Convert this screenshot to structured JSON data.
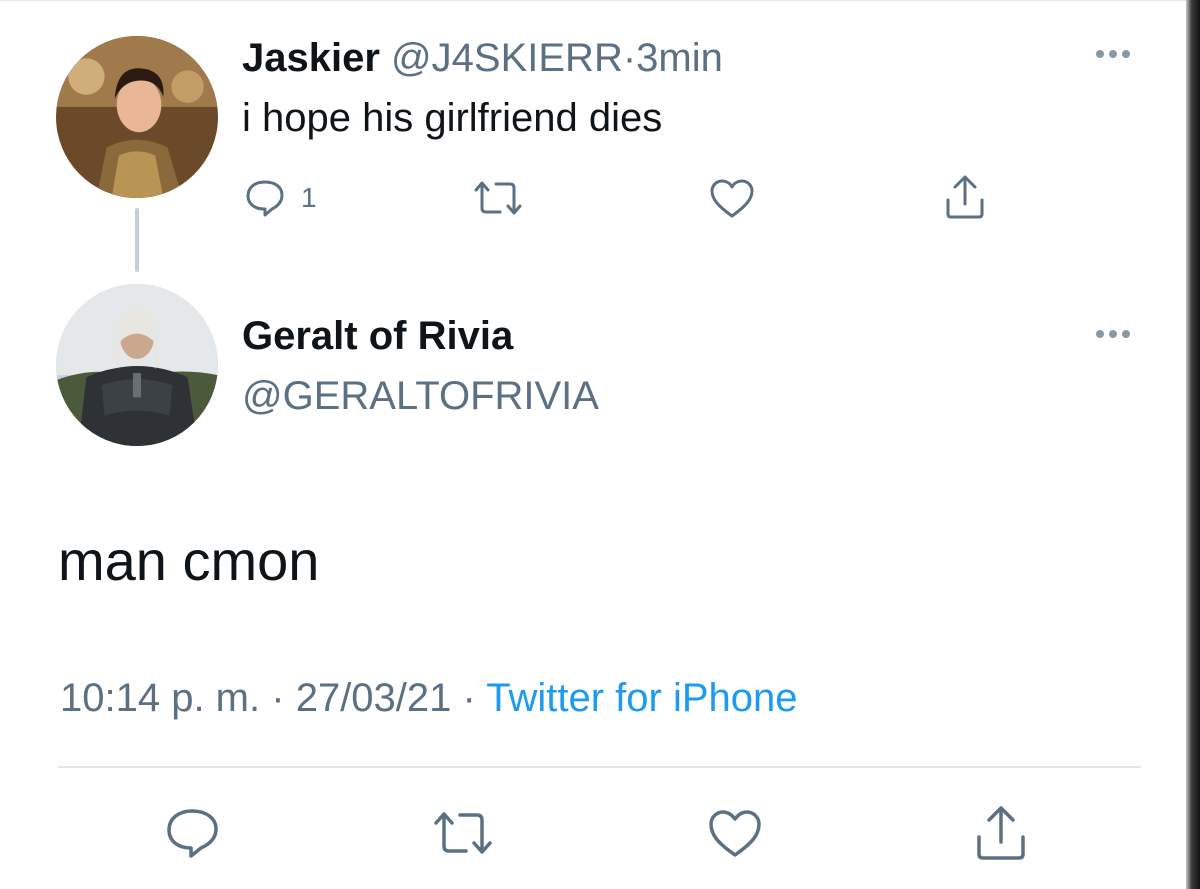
{
  "parent_tweet": {
    "display_name": "Jaskier",
    "handle": "@J4SKIERR",
    "separator": "·",
    "time": "3min",
    "text": "i hope his girlfriend dies",
    "reply_count": "1"
  },
  "main_tweet": {
    "display_name": "Geralt of Rivia",
    "handle": "@GERALTOFRIVIA",
    "text": "man cmon",
    "time": "10:14 p. m.",
    "date": "27/03/21",
    "separator": "·",
    "source": "Twitter for iPhone"
  },
  "colors": {
    "text": "#0f1419",
    "muted": "#5b7083",
    "link": "#1d9bf0",
    "divider": "#e1e8ed"
  },
  "icons": [
    "reply-icon",
    "retweet-icon",
    "like-icon",
    "share-icon",
    "more-icon"
  ]
}
